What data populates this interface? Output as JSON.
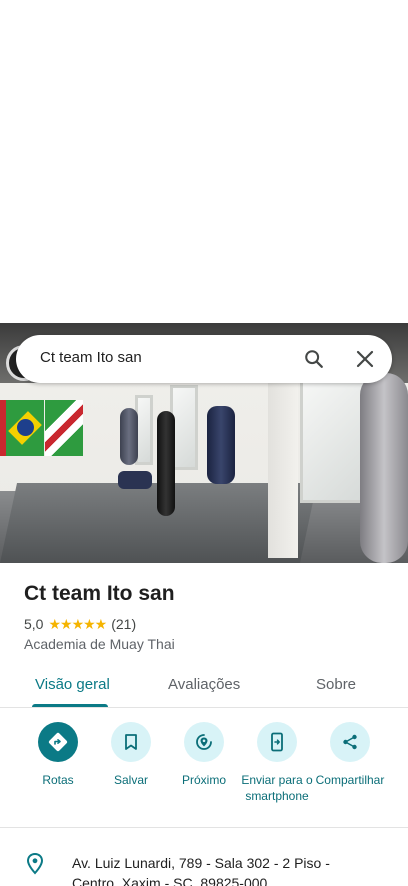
{
  "search": {
    "query": "Ct team Ito san"
  },
  "place": {
    "name": "Ct team Ito san",
    "rating": "5,0",
    "stars": "★★★★★",
    "reviews_count": "(21)",
    "category": "Academia de Muay Thai"
  },
  "tabs": [
    {
      "label": "Visão geral",
      "active": true
    },
    {
      "label": "Avaliações",
      "active": false
    },
    {
      "label": "Sobre",
      "active": false
    }
  ],
  "actions": [
    {
      "label": "Rotas",
      "icon": "directions-icon"
    },
    {
      "label": "Salvar",
      "icon": "bookmark-icon"
    },
    {
      "label": "Próximo",
      "icon": "nearby-icon"
    },
    {
      "label": "Enviar para o smartphone",
      "icon": "send-to-phone-icon"
    },
    {
      "label": "Compartilhar",
      "icon": "share-icon"
    }
  ],
  "address": {
    "text": "Av. Luiz Lunardi, 789 - Sala 302 - 2 Piso - Centro, Xaxim - SC, 89825-000"
  },
  "colors": {
    "accent": "#0b7a86",
    "accent_light": "#d8f3f7",
    "star": "#f5b400"
  }
}
